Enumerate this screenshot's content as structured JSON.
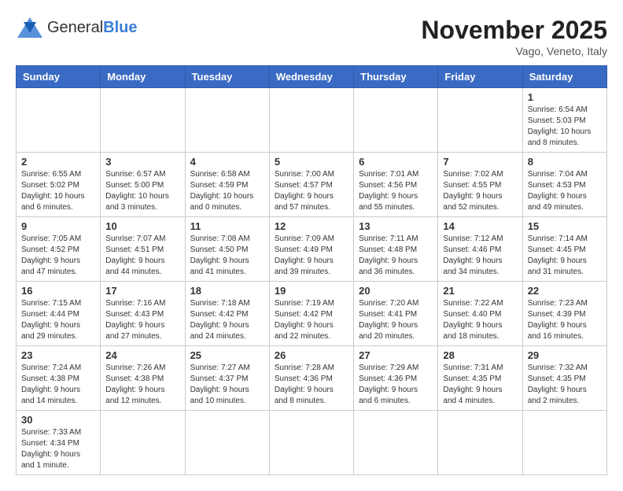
{
  "header": {
    "logo_general": "General",
    "logo_blue": "Blue",
    "month_title": "November 2025",
    "subtitle": "Vago, Veneto, Italy"
  },
  "days_of_week": [
    "Sunday",
    "Monday",
    "Tuesday",
    "Wednesday",
    "Thursday",
    "Friday",
    "Saturday"
  ],
  "weeks": [
    [
      {
        "day": "",
        "info": ""
      },
      {
        "day": "",
        "info": ""
      },
      {
        "day": "",
        "info": ""
      },
      {
        "day": "",
        "info": ""
      },
      {
        "day": "",
        "info": ""
      },
      {
        "day": "",
        "info": ""
      },
      {
        "day": "1",
        "info": "Sunrise: 6:54 AM\nSunset: 5:03 PM\nDaylight: 10 hours and 8 minutes."
      }
    ],
    [
      {
        "day": "2",
        "info": "Sunrise: 6:55 AM\nSunset: 5:02 PM\nDaylight: 10 hours and 6 minutes."
      },
      {
        "day": "3",
        "info": "Sunrise: 6:57 AM\nSunset: 5:00 PM\nDaylight: 10 hours and 3 minutes."
      },
      {
        "day": "4",
        "info": "Sunrise: 6:58 AM\nSunset: 4:59 PM\nDaylight: 10 hours and 0 minutes."
      },
      {
        "day": "5",
        "info": "Sunrise: 7:00 AM\nSunset: 4:57 PM\nDaylight: 9 hours and 57 minutes."
      },
      {
        "day": "6",
        "info": "Sunrise: 7:01 AM\nSunset: 4:56 PM\nDaylight: 9 hours and 55 minutes."
      },
      {
        "day": "7",
        "info": "Sunrise: 7:02 AM\nSunset: 4:55 PM\nDaylight: 9 hours and 52 minutes."
      },
      {
        "day": "8",
        "info": "Sunrise: 7:04 AM\nSunset: 4:53 PM\nDaylight: 9 hours and 49 minutes."
      }
    ],
    [
      {
        "day": "9",
        "info": "Sunrise: 7:05 AM\nSunset: 4:52 PM\nDaylight: 9 hours and 47 minutes."
      },
      {
        "day": "10",
        "info": "Sunrise: 7:07 AM\nSunset: 4:51 PM\nDaylight: 9 hours and 44 minutes."
      },
      {
        "day": "11",
        "info": "Sunrise: 7:08 AM\nSunset: 4:50 PM\nDaylight: 9 hours and 41 minutes."
      },
      {
        "day": "12",
        "info": "Sunrise: 7:09 AM\nSunset: 4:49 PM\nDaylight: 9 hours and 39 minutes."
      },
      {
        "day": "13",
        "info": "Sunrise: 7:11 AM\nSunset: 4:48 PM\nDaylight: 9 hours and 36 minutes."
      },
      {
        "day": "14",
        "info": "Sunrise: 7:12 AM\nSunset: 4:46 PM\nDaylight: 9 hours and 34 minutes."
      },
      {
        "day": "15",
        "info": "Sunrise: 7:14 AM\nSunset: 4:45 PM\nDaylight: 9 hours and 31 minutes."
      }
    ],
    [
      {
        "day": "16",
        "info": "Sunrise: 7:15 AM\nSunset: 4:44 PM\nDaylight: 9 hours and 29 minutes."
      },
      {
        "day": "17",
        "info": "Sunrise: 7:16 AM\nSunset: 4:43 PM\nDaylight: 9 hours and 27 minutes."
      },
      {
        "day": "18",
        "info": "Sunrise: 7:18 AM\nSunset: 4:42 PM\nDaylight: 9 hours and 24 minutes."
      },
      {
        "day": "19",
        "info": "Sunrise: 7:19 AM\nSunset: 4:42 PM\nDaylight: 9 hours and 22 minutes."
      },
      {
        "day": "20",
        "info": "Sunrise: 7:20 AM\nSunset: 4:41 PM\nDaylight: 9 hours and 20 minutes."
      },
      {
        "day": "21",
        "info": "Sunrise: 7:22 AM\nSunset: 4:40 PM\nDaylight: 9 hours and 18 minutes."
      },
      {
        "day": "22",
        "info": "Sunrise: 7:23 AM\nSunset: 4:39 PM\nDaylight: 9 hours and 16 minutes."
      }
    ],
    [
      {
        "day": "23",
        "info": "Sunrise: 7:24 AM\nSunset: 4:38 PM\nDaylight: 9 hours and 14 minutes."
      },
      {
        "day": "24",
        "info": "Sunrise: 7:26 AM\nSunset: 4:38 PM\nDaylight: 9 hours and 12 minutes."
      },
      {
        "day": "25",
        "info": "Sunrise: 7:27 AM\nSunset: 4:37 PM\nDaylight: 9 hours and 10 minutes."
      },
      {
        "day": "26",
        "info": "Sunrise: 7:28 AM\nSunset: 4:36 PM\nDaylight: 9 hours and 8 minutes."
      },
      {
        "day": "27",
        "info": "Sunrise: 7:29 AM\nSunset: 4:36 PM\nDaylight: 9 hours and 6 minutes."
      },
      {
        "day": "28",
        "info": "Sunrise: 7:31 AM\nSunset: 4:35 PM\nDaylight: 9 hours and 4 minutes."
      },
      {
        "day": "29",
        "info": "Sunrise: 7:32 AM\nSunset: 4:35 PM\nDaylight: 9 hours and 2 minutes."
      }
    ],
    [
      {
        "day": "30",
        "info": "Sunrise: 7:33 AM\nSunset: 4:34 PM\nDaylight: 9 hours and 1 minute."
      },
      {
        "day": "",
        "info": ""
      },
      {
        "day": "",
        "info": ""
      },
      {
        "day": "",
        "info": ""
      },
      {
        "day": "",
        "info": ""
      },
      {
        "day": "",
        "info": ""
      },
      {
        "day": "",
        "info": ""
      }
    ]
  ]
}
